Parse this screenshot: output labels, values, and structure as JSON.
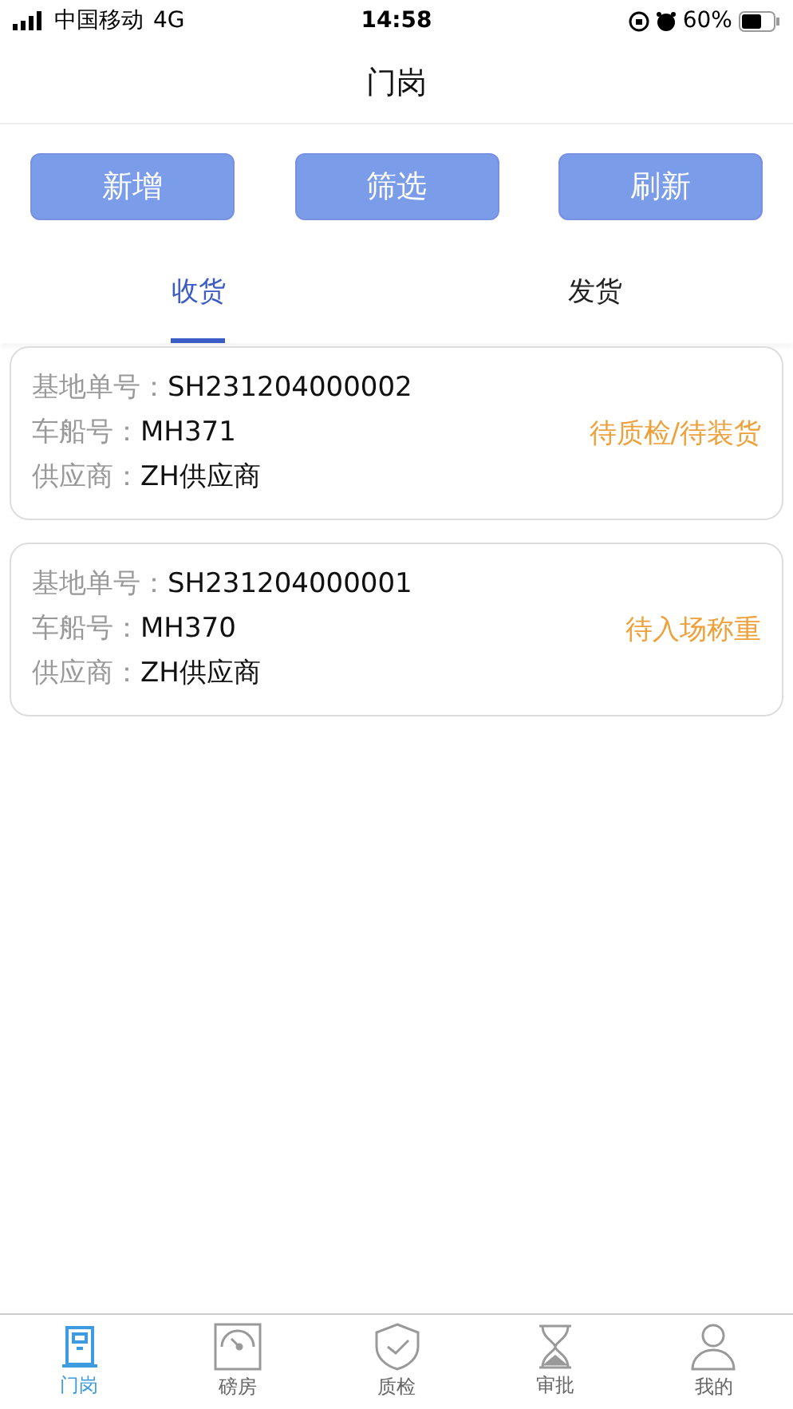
{
  "status_bar": {
    "carrier": "中国移动",
    "network": "4G",
    "time": "14:58",
    "battery": "60%"
  },
  "nav": {
    "title": "门岗"
  },
  "actions": [
    "新增",
    "筛选",
    "刷新"
  ],
  "tabs": [
    {
      "label": "收货",
      "selected": true
    },
    {
      "label": "发货",
      "selected": false
    }
  ],
  "records": [
    {
      "fields": [
        {
          "label": "基地单号：",
          "value": "SH231204000002"
        },
        {
          "label": "车船号：",
          "value": "MH371"
        },
        {
          "label": "供应商：",
          "value": "ZH供应商"
        }
      ],
      "status": "待质检/待装货"
    },
    {
      "fields": [
        {
          "label": "基地单号：",
          "value": "SH231204000001"
        },
        {
          "label": "车船号：",
          "value": "MH370"
        },
        {
          "label": "供应商：",
          "value": "ZH供应商"
        }
      ],
      "status": "待入场称重"
    }
  ],
  "tab_bar": [
    {
      "kind": "gate",
      "label": "门岗",
      "selected": true
    },
    {
      "kind": "gauge",
      "label": "磅房",
      "selected": false
    },
    {
      "kind": "shield",
      "label": "质检",
      "selected": false
    },
    {
      "kind": "hourglass",
      "label": "审批",
      "selected": false
    },
    {
      "kind": "person",
      "label": "我的",
      "selected": false
    }
  ]
}
